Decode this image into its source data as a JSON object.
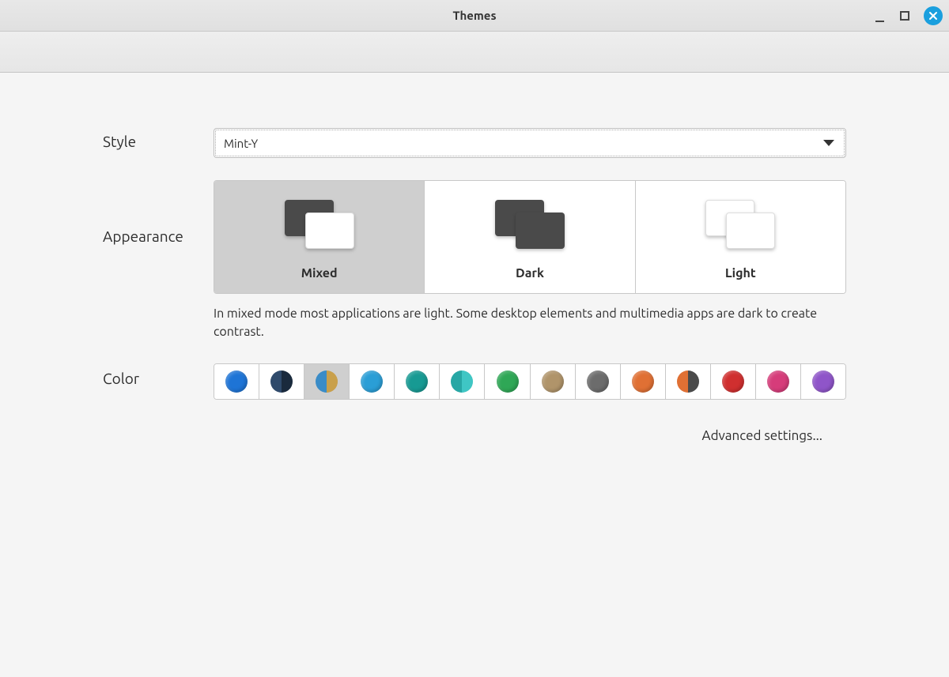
{
  "window": {
    "title": "Themes"
  },
  "style": {
    "label": "Style",
    "selected": "Mint-Y"
  },
  "appearance": {
    "label": "Appearance",
    "selected": "Mixed",
    "options": [
      {
        "id": "mixed",
        "label": "Mixed"
      },
      {
        "id": "dark",
        "label": "Dark"
      },
      {
        "id": "light",
        "label": "Light"
      }
    ],
    "description": "In mixed mode most applications are light. Some desktop elements and multimedia apps are dark to create contrast."
  },
  "color": {
    "label": "Color",
    "selected_index": 2,
    "swatches": [
      {
        "name": "blue",
        "type": "solid",
        "color": "#1e74d6"
      },
      {
        "name": "blue-dark",
        "type": "split",
        "left": "#2f4a6b",
        "right": "#1a2a3d"
      },
      {
        "name": "blue-sand",
        "type": "split",
        "left": "#3a8cc7",
        "right": "#c9a04b"
      },
      {
        "name": "sky",
        "type": "solid",
        "color": "#2a9ed6"
      },
      {
        "name": "teal",
        "type": "solid",
        "color": "#179a93"
      },
      {
        "name": "aqua-split",
        "type": "split",
        "left": "#27a7a5",
        "right": "#3fc6c4"
      },
      {
        "name": "green",
        "type": "solid",
        "color": "#2fa756"
      },
      {
        "name": "sand",
        "type": "solid",
        "color": "#b0946a"
      },
      {
        "name": "grey",
        "type": "solid",
        "color": "#6c6c6c"
      },
      {
        "name": "orange",
        "type": "solid",
        "color": "#e07034"
      },
      {
        "name": "orange-dark",
        "type": "split",
        "left": "#e07034",
        "right": "#4a4a4a"
      },
      {
        "name": "red",
        "type": "solid",
        "color": "#d02f2f"
      },
      {
        "name": "pink",
        "type": "solid",
        "color": "#d63c7a"
      },
      {
        "name": "purple",
        "type": "solid",
        "color": "#8f55c9"
      }
    ]
  },
  "advanced": {
    "label": "Advanced settings..."
  }
}
